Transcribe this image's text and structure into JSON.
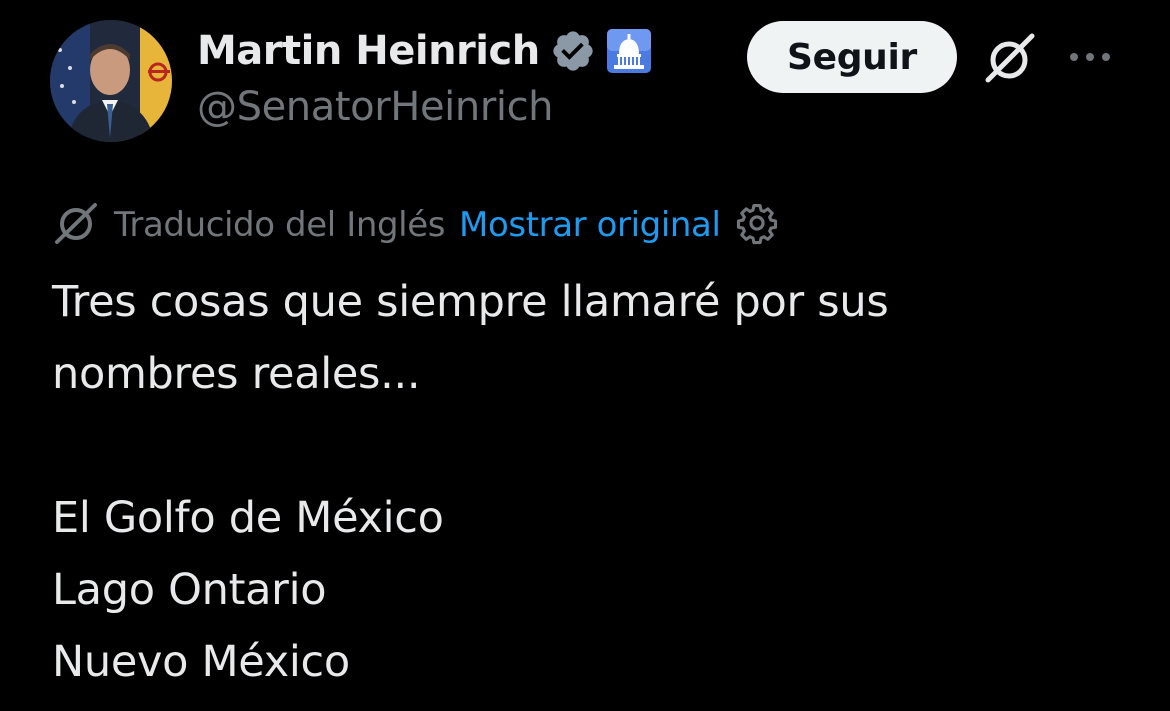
{
  "author": {
    "display_name": "Martin Heinrich",
    "handle": "@SenatorHeinrich",
    "verified_icon": "verified-badge-icon",
    "affiliation_icon": "capitol-dome-icon"
  },
  "actions": {
    "follow_label": "Seguir",
    "grok_icon": "grok-icon",
    "more_icon": "more-options-icon"
  },
  "translation": {
    "label": "Traducido del Inglés",
    "link": "Mostrar original"
  },
  "tweet": {
    "intro_line_1": "Tres cosas que siempre llamaré por sus",
    "intro_line_2": "nombres reales...",
    "items": [
      "El Golfo de México",
      "Lago Ontario",
      "Nuevo México"
    ]
  },
  "colors": {
    "background": "#000000",
    "text": "#e7e9ea",
    "secondary_text": "#71767b",
    "link": "#1d9bf0",
    "verified": "#8b98a5",
    "follow_bg": "#eff3f4"
  }
}
